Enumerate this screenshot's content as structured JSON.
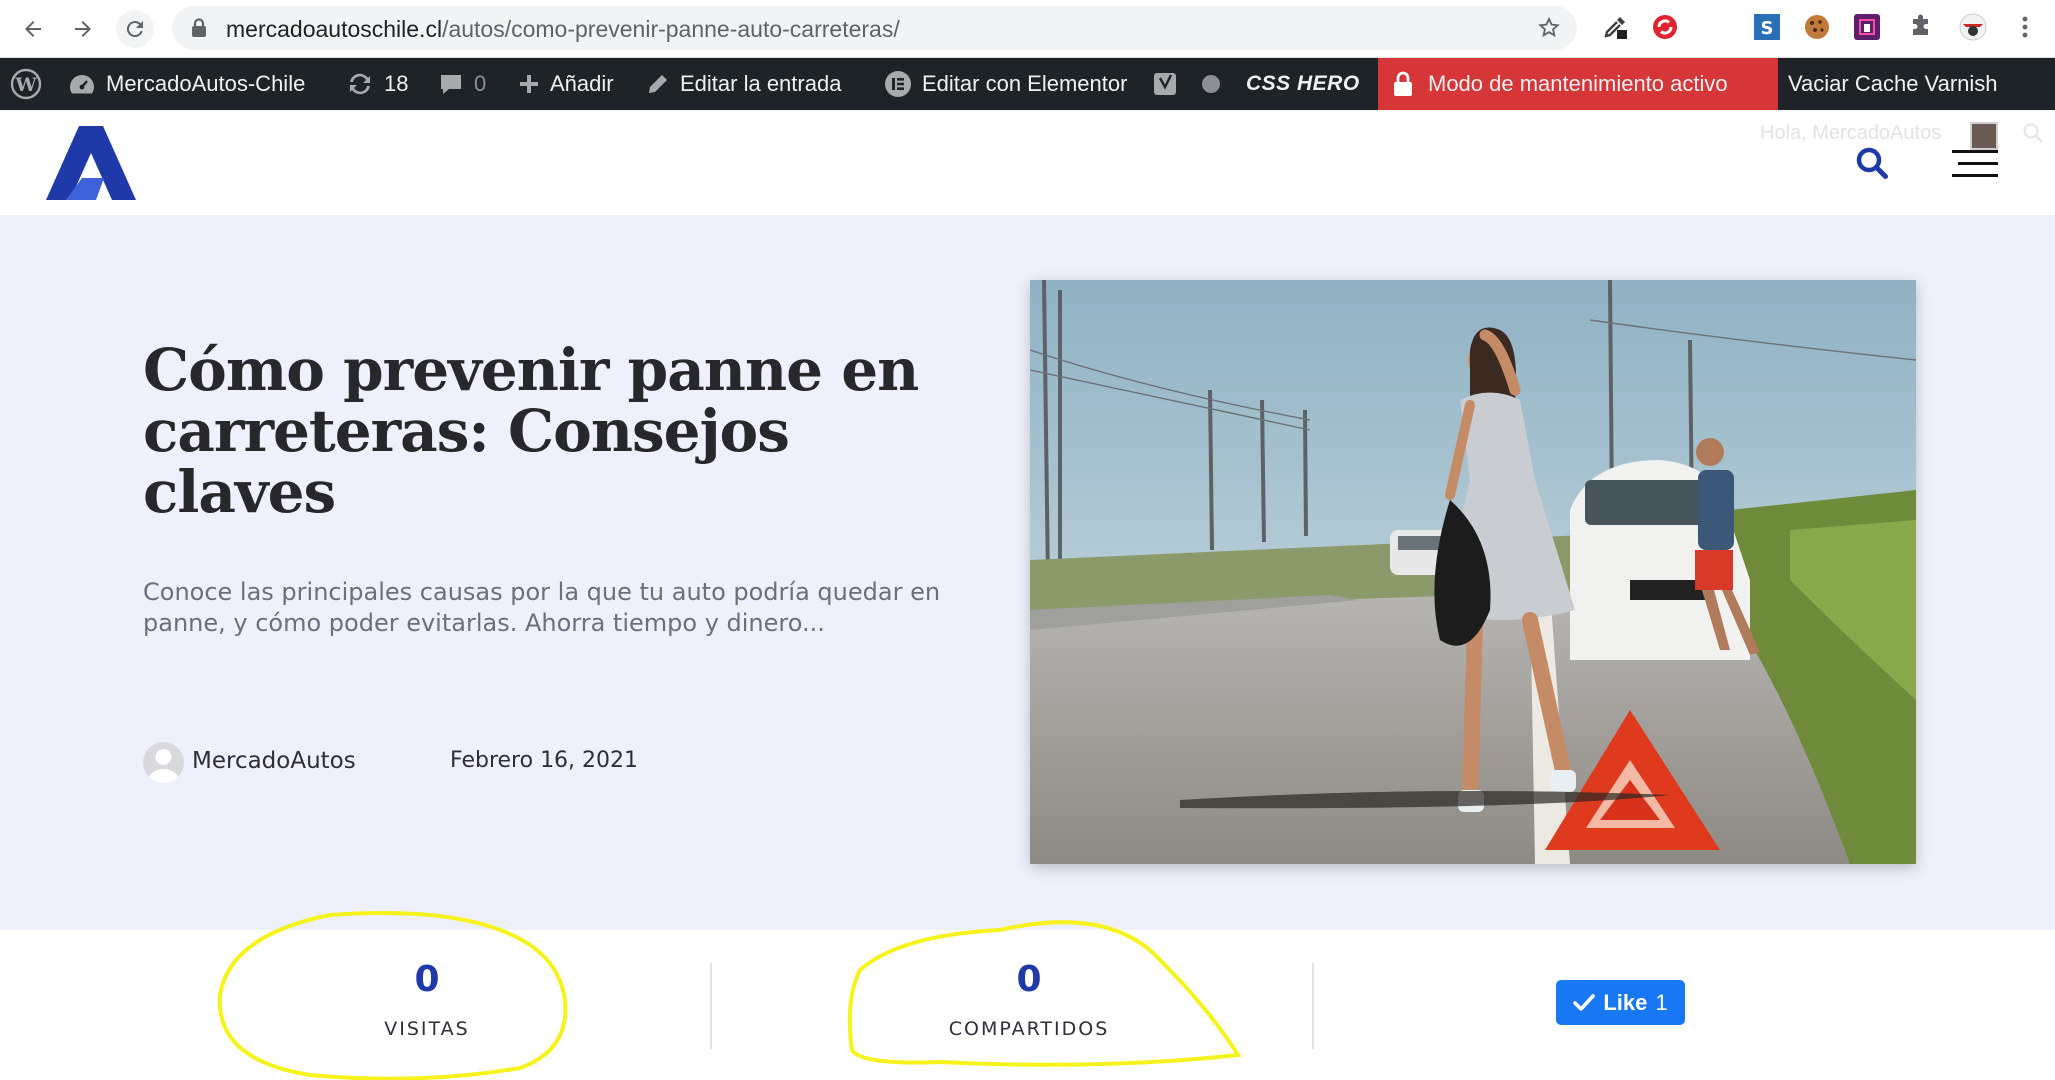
{
  "browser": {
    "url_domain": "mercadoautoschile.cl",
    "url_path": "/autos/como-prevenir-panne-auto-carreteras/"
  },
  "admin_bar": {
    "site_name": "MercadoAutos-Chile",
    "updates_count": "18",
    "comments_count": "0",
    "add_label": "Añadir",
    "edit_post_label": "Editar la entrada",
    "elementor_label": "Editar con Elementor",
    "csshero_label": "CSS HERO",
    "maintenance_label": "Modo de mantenimiento activo",
    "varnish_label": "Vaciar Cache Varnish"
  },
  "header": {
    "greeting": "Hola, MercadoAutos"
  },
  "post": {
    "title": "Cómo prevenir panne en carreteras: Consejos claves",
    "excerpt": "Conoce las principales causas por la que tu auto podría quedar en panne, y cómo poder evitarlas. Ahorra tiempo y dinero...",
    "author": "MercadoAutos",
    "date": "Febrero 16, 2021"
  },
  "stats": {
    "visits_value": "0",
    "visits_label": "VISITAS",
    "shares_value": "0",
    "shares_label": "COMPARTIDOS",
    "like_label": "Like",
    "like_count": "1"
  },
  "colors": {
    "brand_blue": "#1f3aa8",
    "hero_bg": "#eef1fb",
    "admin_bar": "#1d2327",
    "maintenance_red": "#d63638",
    "facebook_blue": "#1877f2",
    "highlight_yellow": "#f6f21b"
  },
  "icons": [
    "back-icon",
    "forward-icon",
    "reload-icon",
    "lock-icon",
    "star-icon",
    "wordpress-icon",
    "dashboard-icon",
    "updates-icon",
    "comments-icon",
    "plus-icon",
    "pencil-icon",
    "elementor-icon",
    "yoast-icon",
    "lock-icon",
    "search-icon",
    "hamburger-menu-icon",
    "checkmark-icon"
  ]
}
